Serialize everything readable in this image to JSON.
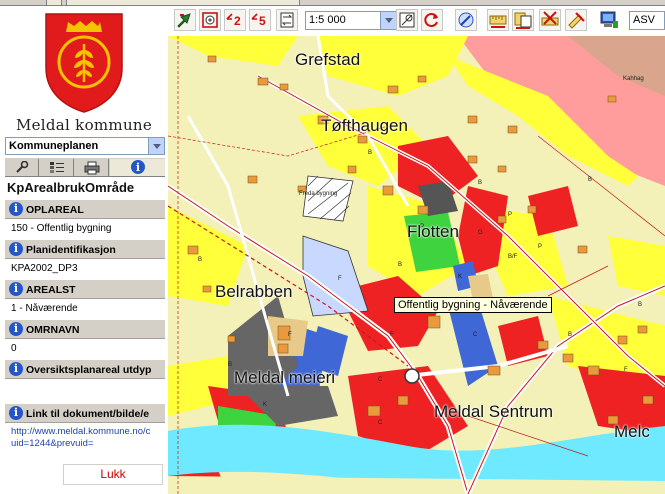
{
  "municipality": {
    "name": "Meldal kommune"
  },
  "layer_select": {
    "value": "Kommuneplanen"
  },
  "panel_tabs": [
    {
      "icon": "wrench-icon"
    },
    {
      "icon": "legend-icon"
    },
    {
      "icon": "printer-icon"
    },
    {
      "icon": "info-icon"
    }
  ],
  "info": {
    "object_title": "KpArealbrukOmråde",
    "attributes": [
      {
        "label": "OPLAREAL",
        "value": "150 - Offentlig bygning"
      },
      {
        "label": "Planidentifikasjon",
        "value": "KPA2002_DP3"
      },
      {
        "label": "AREALST",
        "value": "1 - Nåværende"
      },
      {
        "label": "OMRNAVN",
        "value": "0"
      },
      {
        "label": "Oversiktsplanareal utdyp",
        "value": ""
      },
      {
        "label": "Link til dokument/bilde/e",
        "value": ""
      }
    ],
    "link_line1": "http://www.meldal.kommune.no/c",
    "link_line2": "uid=1244&prevuid=",
    "close_label": "Lukk"
  },
  "toolbar": {
    "scale_value": "1:5 000",
    "search_value": "ASV",
    "zoom_out_2_label": "2",
    "zoom_out_5_label": "5",
    "buttons": [
      {
        "icon": "pan-icon"
      },
      {
        "icon": "zoom-in-icon"
      },
      {
        "icon": "zoom-out-2x-icon"
      },
      {
        "icon": "zoom-out-5x-icon"
      },
      {
        "icon": "swap-extent-icon"
      },
      {
        "icon": "zoom-to-scale-icon"
      },
      {
        "icon": "refresh-icon"
      },
      {
        "icon": "select-object-icon"
      },
      {
        "icon": "measure-distance-icon"
      },
      {
        "icon": "measure-area-icon"
      },
      {
        "icon": "clear-measure-icon"
      },
      {
        "icon": "draw-icon"
      },
      {
        "icon": "computer-icon"
      }
    ]
  },
  "map": {
    "places": [
      "Grefstad",
      "Tøfthaugen",
      "Flotten",
      "Belrabben",
      "Meldal meieri",
      "Meldal Sentrum",
      "Melc"
    ],
    "small_labels": [
      "Freda bygning",
      "Kahhag"
    ],
    "tooltip": "Offentlig bygning - Nåværende",
    "colors": {
      "residential": "#ffff3a",
      "public": "#ee2222",
      "industry": "#3f67d6",
      "park": "#3fd33f",
      "water": "#6ee9ff",
      "agriculture": "#f3f1b8",
      "ownership": "#ff9a9a"
    }
  }
}
